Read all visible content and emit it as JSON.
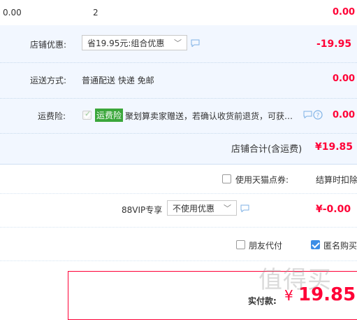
{
  "top": {
    "amount": "0.00",
    "qty": "2",
    "subtotal": "0.00"
  },
  "shop_discount": {
    "label": "店铺优惠:",
    "select_value": "省19.95元:组合优惠",
    "amount": "-19.95"
  },
  "shipping": {
    "label": "运送方式:",
    "value": "普通配送 快递 免邮",
    "amount": "0.00"
  },
  "insurance": {
    "label": "运费险:",
    "tag": "运费险",
    "text": "聚划算卖家赠送，若确认收货前退货，可获…",
    "amount": "0.00"
  },
  "shop_total": {
    "label": "店铺合计(含运费)",
    "amount": "¥19.85"
  },
  "points": {
    "label": "使用天猫点券:",
    "right_text": "结算时扣除"
  },
  "vip": {
    "label": "88VIP专享",
    "select_value": "不使用优惠",
    "amount": "¥-0.00"
  },
  "options": {
    "friend_pay": "朋友代付",
    "anonymous": "匿名购买"
  },
  "payment": {
    "label": "实付款:",
    "currency": "¥",
    "amount": "19.85"
  },
  "watermark": "值得买",
  "colors": {
    "price_red": "#ff0036",
    "shop_bg": "#f2f7ff",
    "checkbox_blue": "#3d8ee6",
    "tag_green": "#3aa63a"
  }
}
